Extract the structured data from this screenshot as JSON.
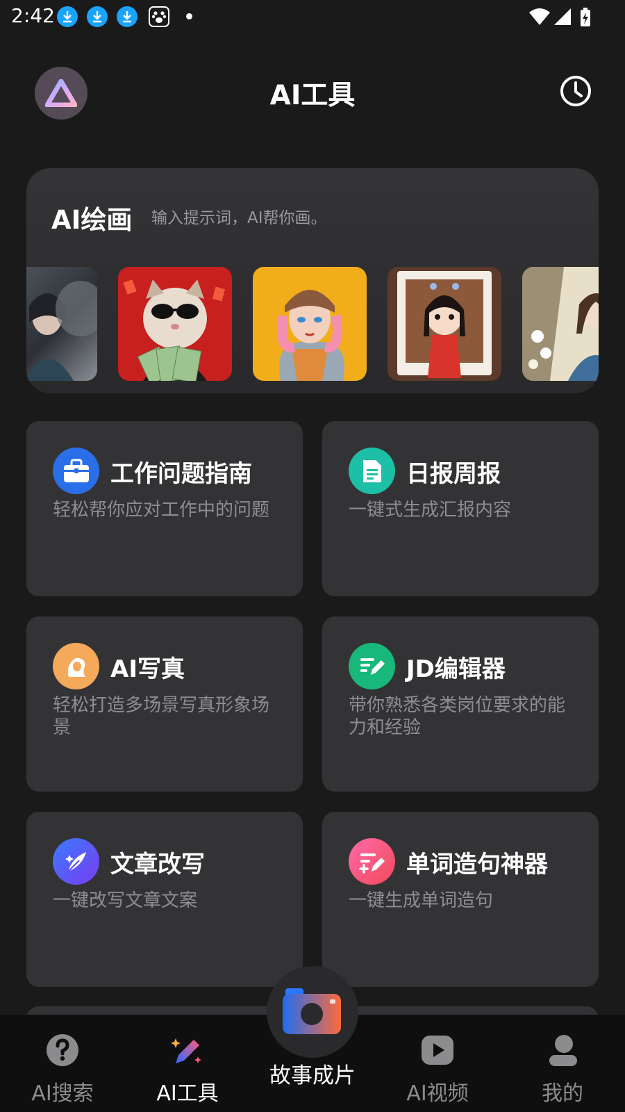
{
  "status_bar": {
    "time": "2:42",
    "icons": [
      "download-icon",
      "download-icon",
      "download-icon",
      "baidu-paw-icon",
      "notification-dot",
      "wifi-icon",
      "signal-icon",
      "battery-charging-icon"
    ]
  },
  "header": {
    "title": "AI工具",
    "avatar_icon": "prism-logo-icon",
    "history_icon": "clock-icon"
  },
  "drawing": {
    "title": "AI绘画",
    "subtitle": "输入提示词，AI帮你画。",
    "samples": [
      {
        "icon": "portrait-woman-ink-image"
      },
      {
        "icon": "cat-sunglasses-money-image"
      },
      {
        "icon": "pink-hair-girl-image"
      },
      {
        "icon": "doll-in-red-dress-image"
      },
      {
        "icon": "girl-with-flowers-image"
      }
    ]
  },
  "tools": [
    {
      "title": "工作问题指南",
      "desc": "轻松帮你应对工作中的问题",
      "icon": "briefcase-icon",
      "color": "#2b6fe8"
    },
    {
      "title": "日报周报",
      "desc": "一键式生成汇报内容",
      "icon": "document-icon",
      "color": "#1dbfa6"
    },
    {
      "title": "AI写真",
      "desc": "轻松打造多场景写真形象场景",
      "icon": "portrait-icon",
      "color": "#f5a95a"
    },
    {
      "title": "JD编辑器",
      "desc": "带你熟悉各类岗位要求的能力和经验",
      "icon": "edit-list-icon",
      "color": "#17b87a"
    },
    {
      "title": "文章改写",
      "desc": "一键改写文章文案",
      "icon": "feather-sparkle-icon",
      "color": "#5a4ff0"
    },
    {
      "title": "单词造句神器",
      "desc": "一键生成单词造句",
      "icon": "word-edit-icon",
      "color": "#f0507a"
    }
  ],
  "bottom_nav": {
    "items": [
      {
        "label": "AI搜索",
        "icon": "question-icon",
        "active": false
      },
      {
        "label": "AI工具",
        "icon": "magic-pen-icon",
        "active": true
      },
      {
        "label": "故事成片",
        "icon": "camera-icon",
        "active": false
      },
      {
        "label": "AI视频",
        "icon": "play-icon",
        "active": false
      },
      {
        "label": "我的",
        "icon": "user-icon",
        "active": false
      }
    ]
  }
}
